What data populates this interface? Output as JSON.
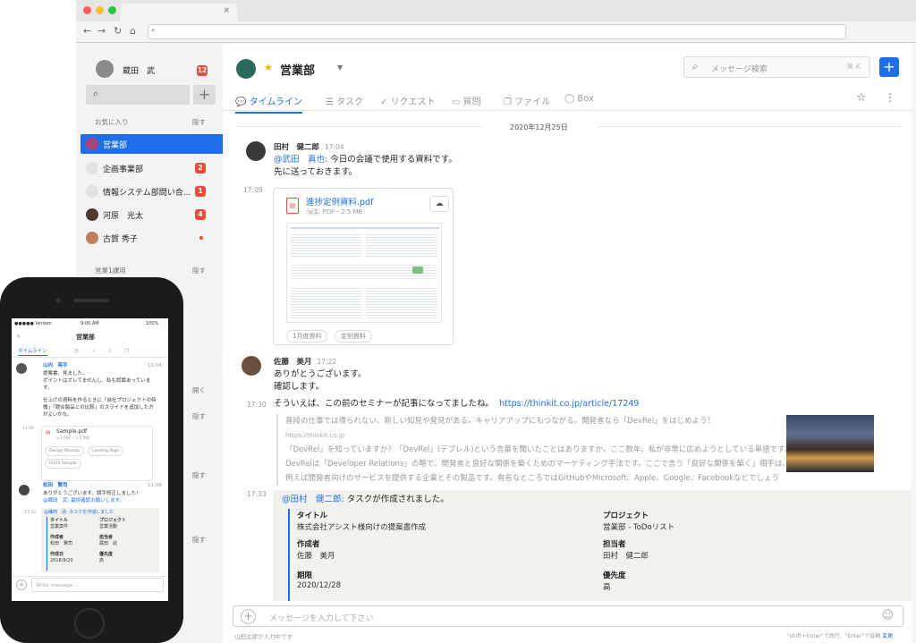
{
  "colors": {
    "accent": "#1d6fe8",
    "badge": "#e74c3c",
    "task_bar": "#1d6fe8"
  },
  "sidebar": {
    "user_name": "蔵田　武",
    "user_badge": "12",
    "fav_label": "お気に入り",
    "hide_label": "隠す",
    "items": [
      {
        "label": "営業部",
        "badge": "",
        "active": true,
        "icon": "team-avatar"
      },
      {
        "label": "企画事業部",
        "badge": "2",
        "icon": "chat-bubble-icon"
      },
      {
        "label": "情報システム部問い合...",
        "badge": "1",
        "icon": "chat-bubble-icon"
      },
      {
        "label": "河原　光太",
        "badge": "4",
        "icon": "user-avatar"
      },
      {
        "label": "古賀 秀子",
        "badge": "",
        "icon": "user-avatar"
      }
    ],
    "section2": "営業1課用",
    "hide2": "隠す",
    "hide3": "隠す",
    "hide4": "隠す",
    "hide5": "隠す",
    "open_label": "開く"
  },
  "header": {
    "channel": "営業部",
    "search_placeholder": "メッセージ検索",
    "search_shortcut": "⌘ K",
    "add": "+"
  },
  "tabs": [
    "タイムライン",
    "タスク",
    "リクエスト",
    "質問",
    "ファイル",
    "Box"
  ],
  "date_divider": "2020年12月25日",
  "messages": {
    "m1_name": "田村　健二郎",
    "m1_time": "17:04",
    "m1_mention": "@武田　真也:",
    "m1_line1": " 今日の会議で使用する資料です。",
    "m1_line2": "先に送っておきます。",
    "file_time": "17:09",
    "file_name": "進捗定例資料.pdf",
    "file_version": "v.1",
    "file_meta": "PDF・2.5 MB",
    "tag1": "1月度資料",
    "tag2": "定例資料",
    "m2_name": "佐藤　美月",
    "m2_time": "17:22",
    "m2_line1": "ありがとうございます。",
    "m2_line2": "確認します。",
    "m3_time": "17:30",
    "m3_text": "そういえば、この前のセミナーが記事になってましたね。",
    "m3_link": "https://thinkit.co.jp/article/17249",
    "og_title": "普段の仕事では得られない、新しい知見や発見がある。キャリアアップにもつながる。開発者なら「DevRel」をはじめよう！",
    "og_url": "https://thinkit.co.jp",
    "og_desc1": "「DevRel」を知っていますか？「DevRel」(デブレル)という言葉を聞いたことはありますか。ここ数年、私が非常に広めようとしている単語です。",
    "og_desc2": "DevRelは「Developer Relations」の略で、開発者と良好な関係を築くためのマーケティング手法です。ここで言う「良好な関係を築く」相手は、",
    "og_desc3": "例えば開発者向けのサービスを提供する企業とその製品です。有名なところではGitHubやMicrosoft、Apple、Google、Facebookなどでしょう",
    "task_time": "17:33",
    "task_mention": "@田村　健二郎:",
    "task_head": " タスクが作成されました。"
  },
  "task": {
    "title_k": "タイトル",
    "title_v": "株式会社アシスト様向けの提案書作成",
    "project_k": "プロジェクト",
    "project_v": "営業部 - ToDoリスト",
    "author_k": "作成者",
    "author_v": "佐藤　美月",
    "assignee_k": "担当者",
    "assignee_v": "田村　健二郎",
    "due_k": "期限",
    "due_v": "2020/12/28",
    "priority_k": "優先度",
    "priority_v": "高"
  },
  "composer": {
    "placeholder": "メッセージを入力して下さい",
    "typing": "山田太郎が入力中です",
    "hint": "\"shift＋Enter\"で改行、\"Enter\"で投稿",
    "change": "変更"
  },
  "phone": {
    "carrier": "●●●●● Verizon",
    "clock": "9:00 AM",
    "battery": "100%",
    "channel": "営業部",
    "tab": "タイムライン",
    "p1_name": "山内　亮平",
    "p1_time": "11:04",
    "p1_l1": "提案書、見ました。",
    "p1_l2": "ポイントはズレてませんし、私も認識あっていま",
    "p1_l3": "す。",
    "p1_l4": "仕上げの資料を作るときに「自社プロジェクトの特",
    "p1_l5": "徴」「競合製品との比較」のスライドを追加した方",
    "p1_l6": "がよいかな。",
    "p_file_time": "11:06",
    "p_file": "Sample.pdf",
    "p_file_meta": "v.1  PDF・2.5 MB",
    "p_tag1": "Design Mockup",
    "p_tag2": "Landing Page",
    "p_tag3": "UI/UX Sample",
    "p2_name": "松田　賢司",
    "p2_time": "11:06",
    "p2_l1": "ありがとうございます。誤字修正しました！",
    "p2_l2": "@織田　武: 最終確認お願いします。",
    "p_task_time": "17:33",
    "p_task_head": "@織田　武: タスクを作成しました",
    "pt_k1": "タイトル",
    "pt_v1": "営業案件",
    "pt_k2": "プロジェクト",
    "pt_v2": "営業活動",
    "pt_k3": "作成者",
    "pt_v3": "松田　賢司",
    "pt_k4": "担当者",
    "pt_v4": "蔵田　武",
    "pt_k5": "作成日",
    "pt_v5": "2018/9/20",
    "pt_k6": "優先度",
    "pt_v6": "高",
    "p_input": "Write message ..."
  }
}
